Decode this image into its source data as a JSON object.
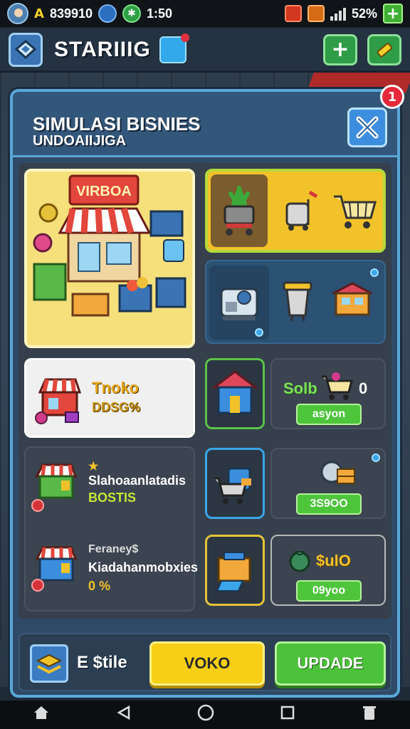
{
  "status_bar": {
    "coin_letter": "A",
    "coins": "839910",
    "time": "1:50",
    "battery": "52%"
  },
  "header": {
    "title": "STARIIIG"
  },
  "panel": {
    "title": "SIMULASI BISNIES",
    "subtitle": "UNDOAIIJIGA",
    "notification_count": "1"
  },
  "cards": {
    "toko": {
      "label": "Tnoko",
      "value": "DDSG%"
    },
    "sell": {
      "label": "Solb",
      "suffix": "0",
      "button": "asyon"
    },
    "shop2": {
      "button": "3S9OO"
    },
    "cash": {
      "label": "$ulO",
      "button": "09yoo"
    },
    "list1": {
      "name": "Slahoaanlatadis",
      "value": "BOSTIS"
    },
    "list2": {
      "top": "Feraney$",
      "name": "Kiadahanmobxies",
      "value": "0 %"
    },
    "featured_sign": "VIRBOA"
  },
  "footer": {
    "label": "E $tile",
    "primary_button": "VOKO",
    "secondary_button": "UPDADE"
  },
  "colors": {
    "accent_blue": "#5aa7d8",
    "primary_yellow": "#f7cf16",
    "secondary_green": "#4cc23a"
  }
}
